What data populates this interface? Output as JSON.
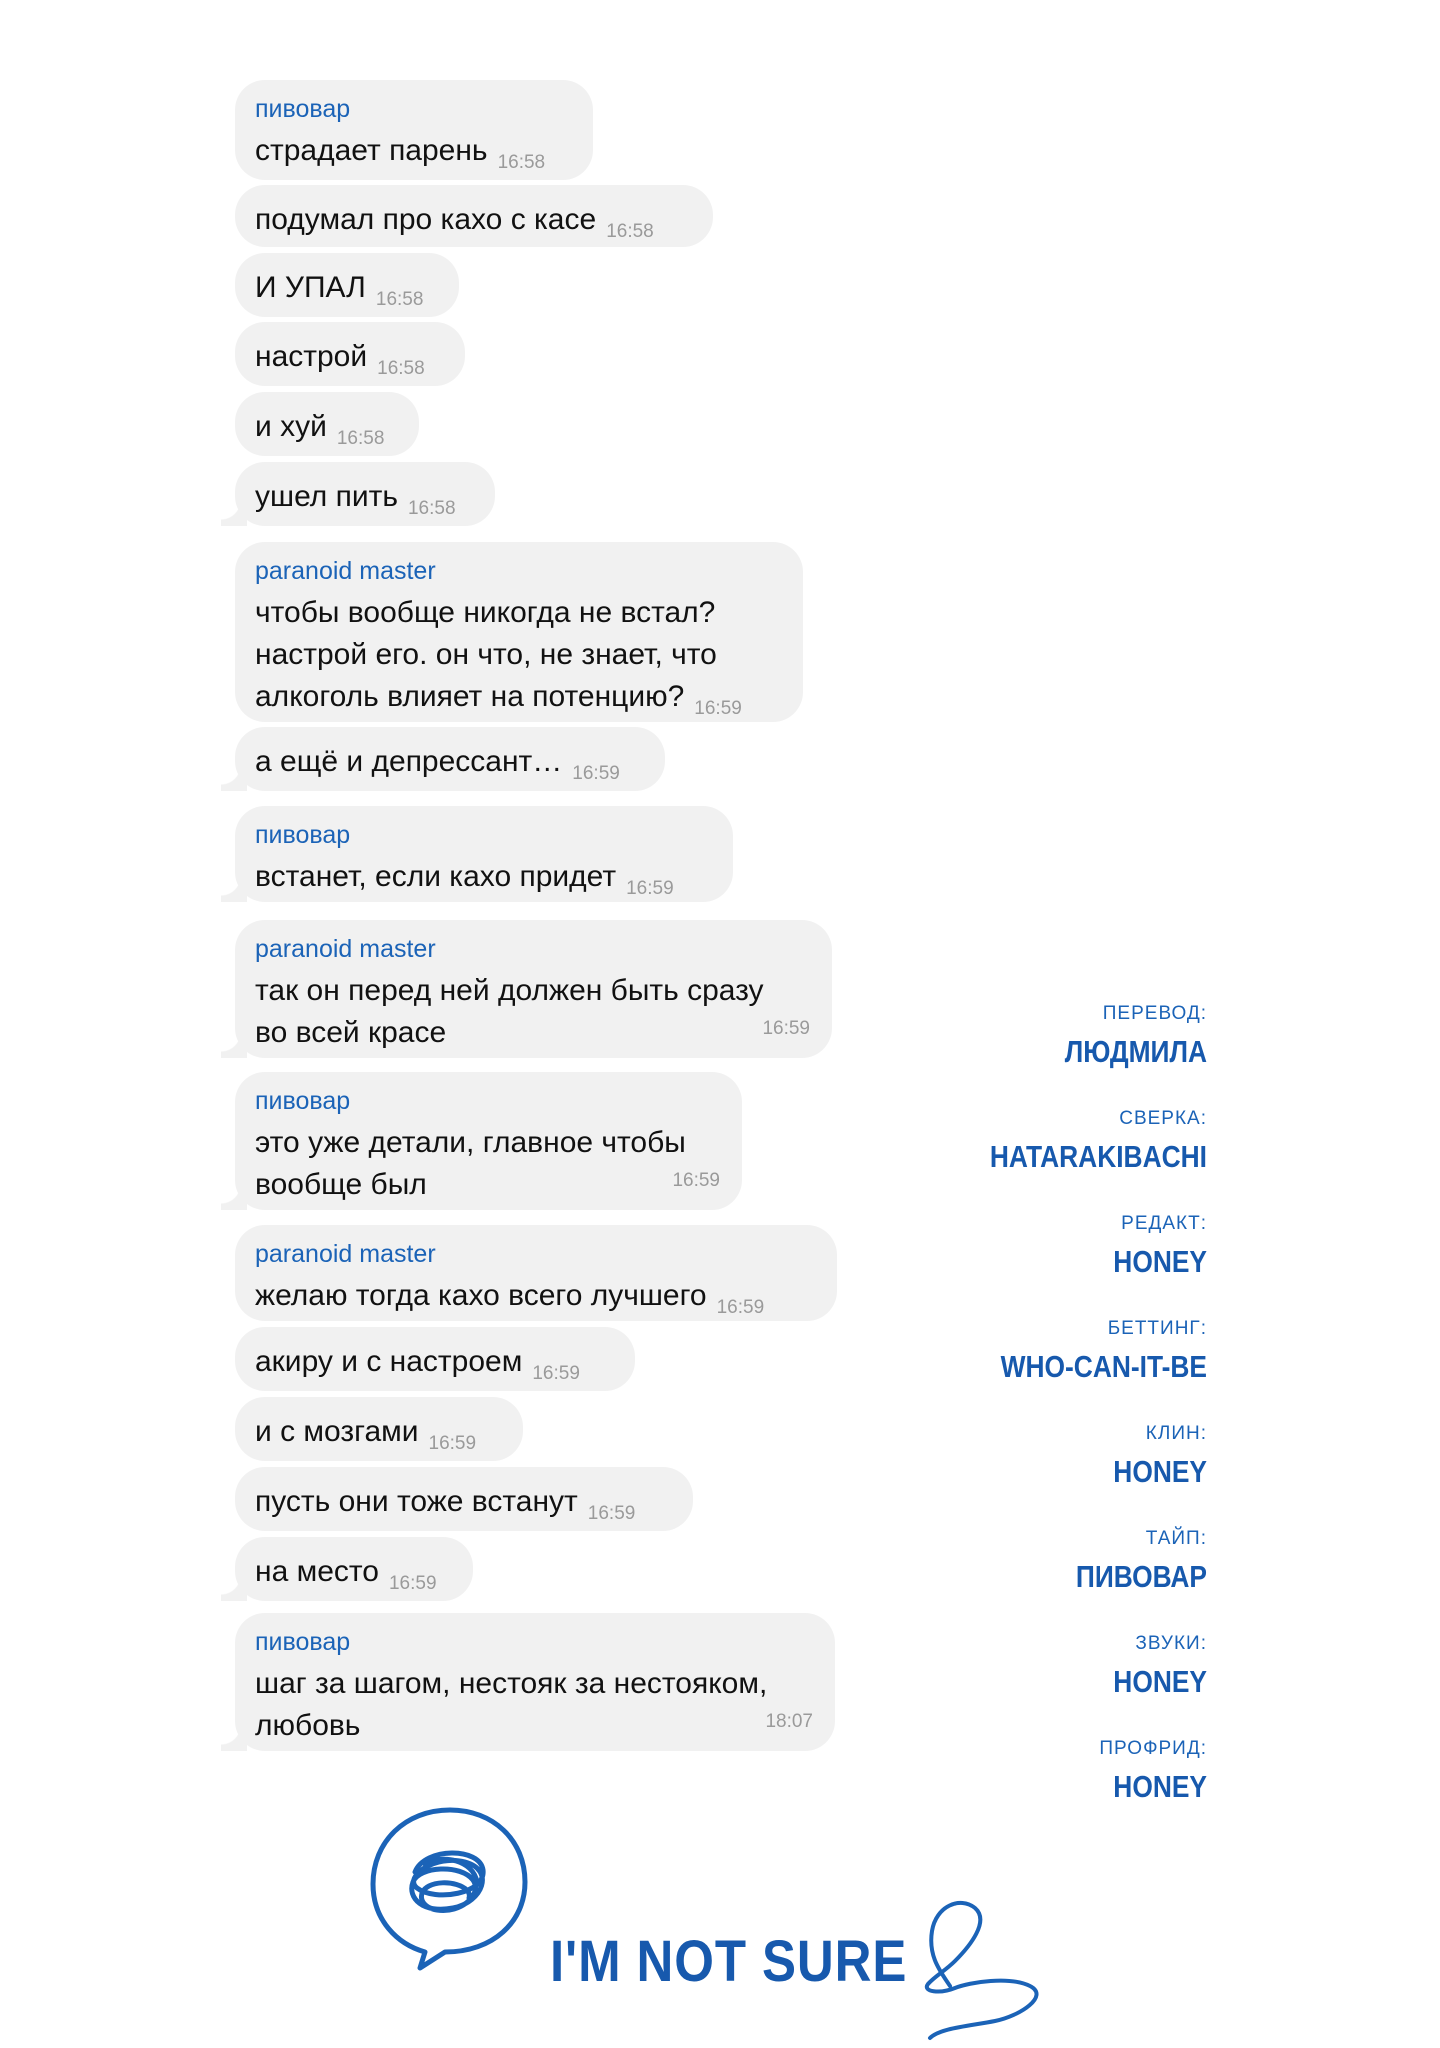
{
  "messages": [
    {
      "sender": "пивовар",
      "text": "страдает парень",
      "time": "16:58"
    },
    {
      "sender": "",
      "text": "подумал про кахо с касе",
      "time": "16:58"
    },
    {
      "sender": "",
      "text": "И УПАЛ",
      "time": "16:58"
    },
    {
      "sender": "",
      "text": "настрой",
      "time": "16:58"
    },
    {
      "sender": "",
      "text": "и хуй",
      "time": "16:58"
    },
    {
      "sender": "",
      "text": "ушел пить",
      "time": "16:58"
    },
    {
      "sender": "paranoid master",
      "text": "чтобы вообще никогда не встал?\nнастрой его. он что, не знает, что\nалкоголь влияет на потенцию?",
      "time": "16:59"
    },
    {
      "sender": "",
      "text": "а ещё и депрессант…",
      "time": "16:59"
    },
    {
      "sender": "пивовар",
      "text": "встанет, если кахо придет",
      "time": "16:59"
    },
    {
      "sender": "paranoid master",
      "text": "так он перед ней должен быть сразу\nво всей красе",
      "time": "16:59"
    },
    {
      "sender": "пивовар",
      "text": "это уже детали, главное чтобы\nвообще был",
      "time": "16:59"
    },
    {
      "sender": "paranoid master",
      "text": "желаю тогда кахо всего лучшего",
      "time": "16:59"
    },
    {
      "sender": "",
      "text": "акиру и с настроем",
      "time": "16:59"
    },
    {
      "sender": "",
      "text": "и с мозгами",
      "time": "16:59"
    },
    {
      "sender": "",
      "text": "пусть они тоже встанут",
      "time": "16:59"
    },
    {
      "sender": "",
      "text": "на место",
      "time": "16:59"
    },
    {
      "sender": "пивовар",
      "text": "шаг за шагом, нестояк за нестояком,\nлюбовь",
      "time": "18:07"
    }
  ],
  "credits": [
    {
      "role": "ПЕРЕВОД:",
      "name": "ЛЮДМИЛА"
    },
    {
      "role": "СВЕРКА:",
      "name": "HATARAKIBACHI"
    },
    {
      "role": "РЕДАКТ:",
      "name": "HONEY"
    },
    {
      "role": "БЕТТИНГ:",
      "name": "WHO-CAN-IT-BE"
    },
    {
      "role": "КЛИН:",
      "name": "HONEY"
    },
    {
      "role": "ТАЙП:",
      "name": "ПИВОВАР"
    },
    {
      "role": "ЗВУКИ:",
      "name": "HONEY"
    },
    {
      "role": "ПРОФРИД:",
      "name": "HONEY"
    }
  ],
  "footer": {
    "logo_text": "I'M NOT SURE"
  },
  "colors": {
    "accent": "#1b63b7",
    "bubble": "#f1f1f1",
    "time": "#9a9a9a",
    "text": "#111111"
  },
  "icons": {
    "logo": "scribble-speech-bubble-icon",
    "squiggle": "squiggle-line-icon"
  }
}
